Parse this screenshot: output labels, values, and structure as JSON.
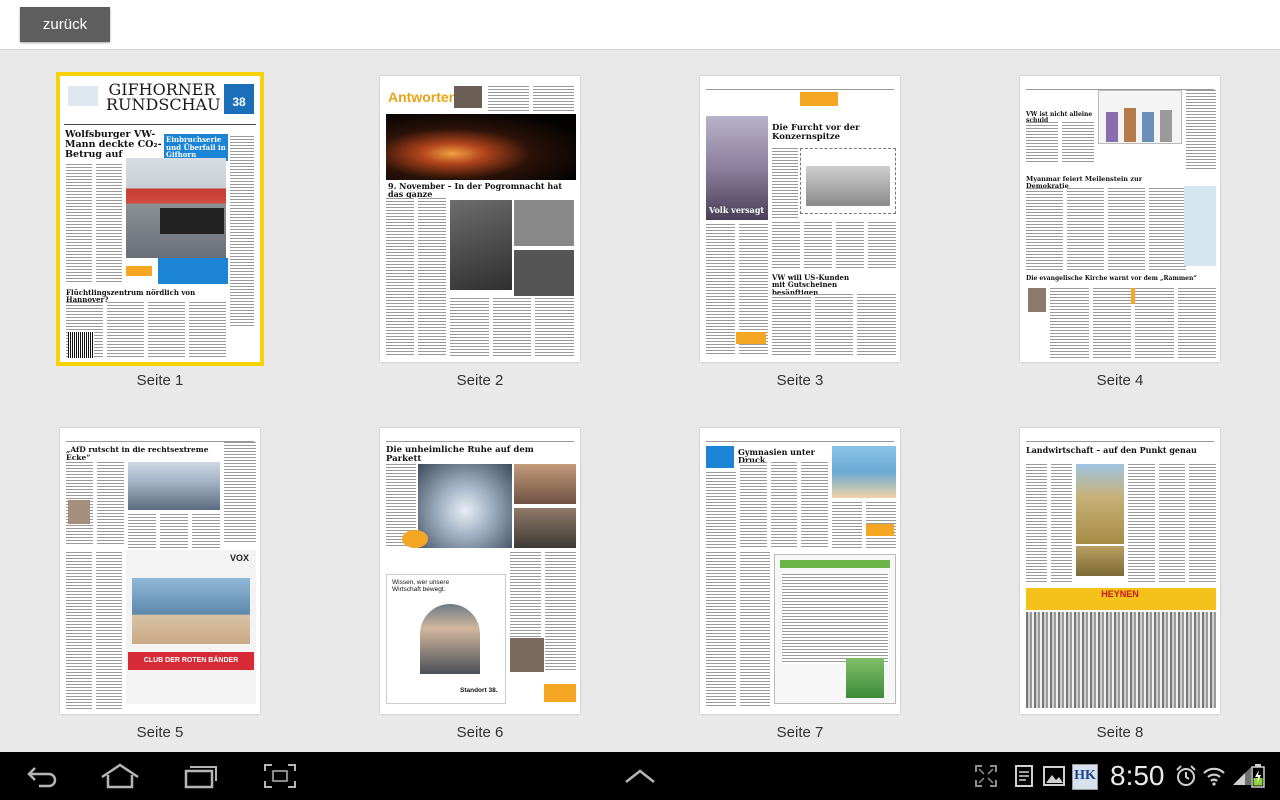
{
  "toolbar": {
    "back_label": "zurück"
  },
  "pages": [
    {
      "caption": "Seite 1",
      "selected": true,
      "masthead": "GIFHORNER RUNDSCHAU",
      "headline": "Wolfsburger VW-Mann deckte CO₂-Betrug auf",
      "side_headline": "Einbruchserie und Überfall in Gifhorn",
      "bottom_headline": "Flüchtlingszentrum nördlich von Hannover?",
      "badge_number": "38"
    },
    {
      "caption": "Seite 2",
      "selected": false,
      "headline": "Antworten",
      "sub_headline": "9. November – In der Pogromnacht hat das ganze"
    },
    {
      "caption": "Seite 3",
      "selected": false,
      "headline": "Die Furcht vor der Konzernspitze",
      "photo_label": "Volk versagt",
      "bottom_headline": "VW will US-Kunden mit Gutscheinen besänftigen"
    },
    {
      "caption": "Seite 4",
      "selected": false,
      "headline": "VW ist nicht alleine schuld",
      "mid_headline": "Myanmar feiert Meilenstein zur Demokratie",
      "bottom_headline": "Die evangelische Kirche warnt vor dem „Rammen“"
    },
    {
      "caption": "Seite 5",
      "selected": false,
      "headline": "„AfD rutscht in die rechtsextreme Ecke“",
      "ad_text": "CLUB DER ROTEN BÄNDER",
      "ad_brand": "VOX"
    },
    {
      "caption": "Seite 6",
      "selected": false,
      "headline": "Die unheimliche Ruhe auf dem Parkett",
      "ad_text": "Wissen, wer unsere Wirtschaft bewegt.",
      "ad_brand": "Standort 38."
    },
    {
      "caption": "Seite 7",
      "selected": false,
      "headline": "Gymnasien unter Druck"
    },
    {
      "caption": "Seite 8",
      "selected": false,
      "headline": "Landwirtschaft – auf den Punkt genau",
      "ad_text": "HEYNEN"
    }
  ],
  "status_bar": {
    "time": "8:50",
    "app_badge": "HK"
  },
  "colors": {
    "selection": "#f7d10a",
    "back_button": "#5e5e5e",
    "navbar": "#000000"
  }
}
